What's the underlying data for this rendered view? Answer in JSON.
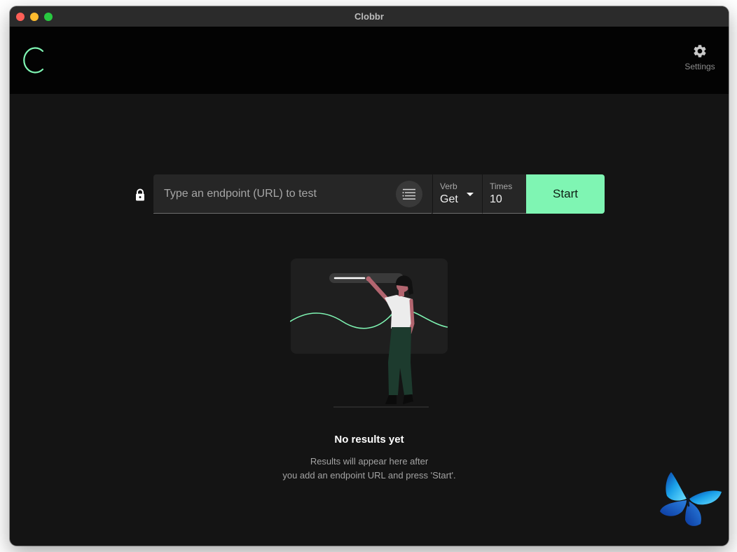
{
  "window": {
    "title": "Clobbr"
  },
  "header": {
    "settings_label": "Settings"
  },
  "request_bar": {
    "url_placeholder": "Type an endpoint (URL) to test",
    "url_value": "",
    "verb_label": "Verb",
    "verb_value": "Get",
    "times_label": "Times",
    "times_value": "10",
    "start_label": "Start"
  },
  "empty_state": {
    "title": "No results yet",
    "line1": "Results will appear here after",
    "line2": "you add an endpoint URL and press 'Start'."
  },
  "colors": {
    "accent": "#7ff5b3",
    "background": "#141414",
    "header_background": "#030303"
  },
  "icons": [
    "close-window",
    "minimize-window",
    "maximize-window",
    "clobbr-logo",
    "gear-icon",
    "lock-icon",
    "options-list-icon",
    "chevron-down-icon",
    "butterfly"
  ]
}
